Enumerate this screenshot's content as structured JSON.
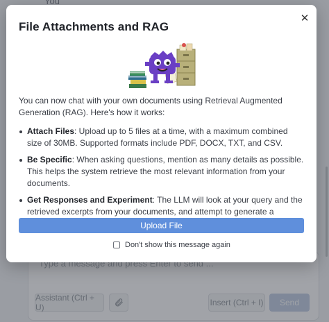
{
  "background": {
    "top_label": "You",
    "composer_placeholder": "Type a message and press Enter to send ...",
    "assistant_button": "Assistant (Ctrl + U)",
    "insert_button": "Insert (Ctrl + I)",
    "send_button": "Send",
    "attach_icon": "paperclip-icon"
  },
  "modal": {
    "title": "File Attachments and RAG",
    "close_icon": "close-icon",
    "intro": "You can now chat with your own documents using Retrieval Augmented Generation (RAG). Here's how it works:",
    "bullets": [
      {
        "term": "Attach Files",
        "text": ": Upload up to 5 files at a time, with a maximum combined size of 30MB. Supported formats include PDF, DOCX, TXT, and CSV."
      },
      {
        "term": "Be Specific",
        "text": ": When asking questions, mention as many details as possible. This helps the system retrieve the most relevant information from your documents."
      },
      {
        "term": "Get Responses and Experiment",
        "text": ": The LLM will look at your query and the retrieved excerpts from your documents, and attempt to generate a response. Experiment with different queries to find what works best."
      }
    ],
    "upload_button": "Upload File",
    "dont_show_label": "Don't show this message again",
    "dont_show_checked": false
  },
  "colors": {
    "primary": "#5f8fdc",
    "mascot": "#6a3fc4"
  }
}
